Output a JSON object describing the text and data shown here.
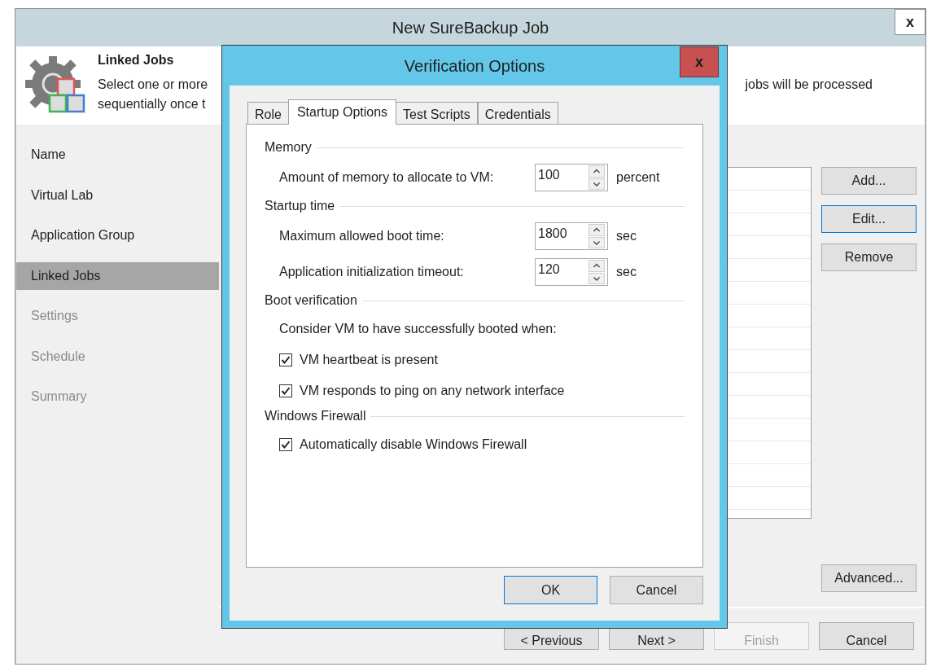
{
  "window": {
    "title": "New SureBackup Job",
    "close_label": "x"
  },
  "header": {
    "title": "Linked Jobs",
    "line_1_start": "Select one or more",
    "line_1_end": "jobs will be processed",
    "line_2_start": "sequentially once t"
  },
  "sidebar": {
    "items": [
      {
        "label": "Name",
        "selected": false,
        "disabled": false
      },
      {
        "label": "Virtual Lab",
        "selected": false,
        "disabled": false
      },
      {
        "label": "Application Group",
        "selected": false,
        "disabled": false
      },
      {
        "label": "Linked Jobs",
        "selected": true,
        "disabled": false
      },
      {
        "label": "Settings",
        "selected": false,
        "disabled": true
      },
      {
        "label": "Schedule",
        "selected": false,
        "disabled": true
      },
      {
        "label": "Summary",
        "selected": false,
        "disabled": true
      }
    ]
  },
  "side_buttons": [
    {
      "label": "Add...",
      "focused": false
    },
    {
      "label": "Edit...",
      "focused": true
    },
    {
      "label": "Remove",
      "focused": false
    }
  ],
  "advanced_button": {
    "label": "Advanced..."
  },
  "footer_buttons": [
    {
      "label": "< Previous",
      "disabled": false
    },
    {
      "label": "Next >",
      "disabled": false
    },
    {
      "label": "Finish",
      "disabled": true
    },
    {
      "label": "Cancel",
      "disabled": false
    }
  ],
  "dialog": {
    "title": "Verification Options",
    "close_label": "x",
    "tabs": [
      {
        "label": "Role",
        "selected": false
      },
      {
        "label": "Startup Options",
        "selected": true
      },
      {
        "label": "Test Scripts",
        "selected": false
      },
      {
        "label": "Credentials",
        "selected": false
      }
    ],
    "sections": [
      {
        "title": "Memory",
        "rows": [
          {
            "kind": "spin",
            "label": "Amount of memory to allocate to VM:",
            "value": "100",
            "unit": "percent"
          }
        ]
      },
      {
        "title": "Startup time",
        "rows": [
          {
            "kind": "spin",
            "label": "Maximum allowed boot time:",
            "value": "1800",
            "unit": "sec"
          },
          {
            "kind": "spin",
            "label": "Application initialization timeout:",
            "value": "120",
            "unit": "sec"
          }
        ]
      },
      {
        "title": "Boot verification",
        "rows": [
          {
            "kind": "text",
            "text": "Consider VM to have successfully booted when:"
          },
          {
            "kind": "checkbox",
            "label": "VM heartbeat is present",
            "checked": true
          },
          {
            "kind": "checkbox",
            "label": "VM responds to ping on any network interface",
            "checked": true
          }
        ]
      },
      {
        "title": "Windows Firewall",
        "rows": [
          {
            "kind": "checkbox",
            "label": "Automatically disable Windows Firewall",
            "checked": true
          }
        ]
      }
    ],
    "buttons": [
      {
        "label": "OK",
        "focused": true
      },
      {
        "label": "Cancel",
        "focused": false
      }
    ]
  }
}
